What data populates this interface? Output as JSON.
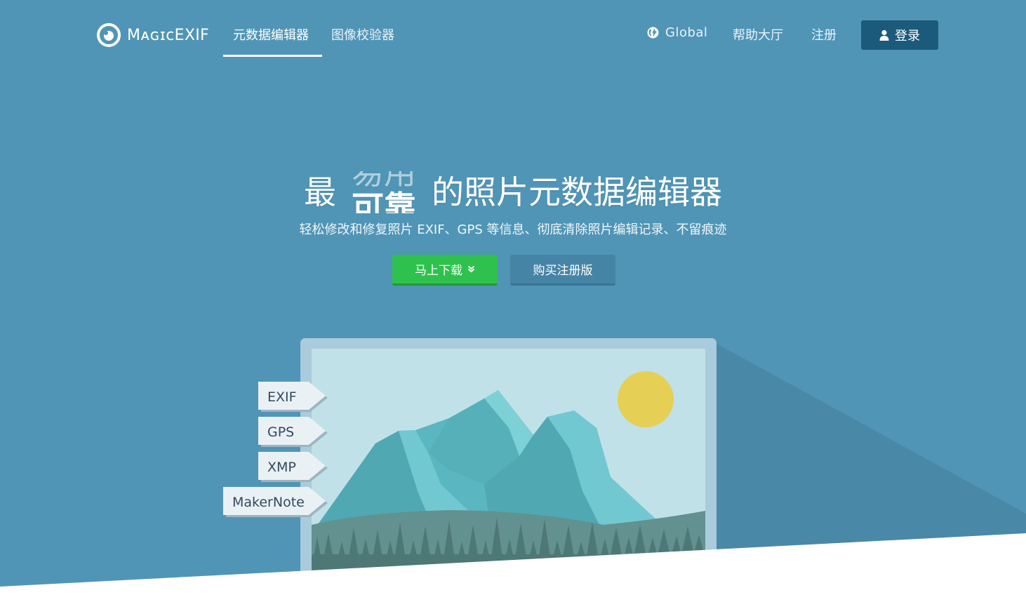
{
  "brand": {
    "name": "MagicEXIF",
    "logo_text_display": "MᴀɢɪᴄEXIF"
  },
  "nav": {
    "items": [
      {
        "label": "元数据编辑器",
        "active": true
      },
      {
        "label": "图像校验器",
        "active": false
      }
    ],
    "right": {
      "global_label": "Global",
      "help_label": "帮助大厅",
      "register_label": "注册",
      "login_label": "登录"
    }
  },
  "hero": {
    "title_prefix": "最",
    "rotating_previous": "易用",
    "rotating_current": "可靠",
    "title_suffix": "的照片元数据编辑器",
    "subtitle": "轻松修改和修复照片 EXIF、GPS 等信息、彻底清除照片编辑记录、不留痕迹",
    "download_label": "马上下载",
    "buy_label": "购买注册版"
  },
  "tags": [
    "EXIF",
    "GPS",
    "XMP",
    "MakerNote"
  ],
  "colors": {
    "background": "#5095b6",
    "login_button": "#1b5a7a",
    "download_button": "#2fc14d",
    "buy_button": "#4684a5",
    "sun": "#e5cf55"
  },
  "icons": {
    "logo": "magicexif-lens-icon",
    "global": "globe-icon",
    "login": "user-icon",
    "download": "double-chevron-down-icon"
  }
}
